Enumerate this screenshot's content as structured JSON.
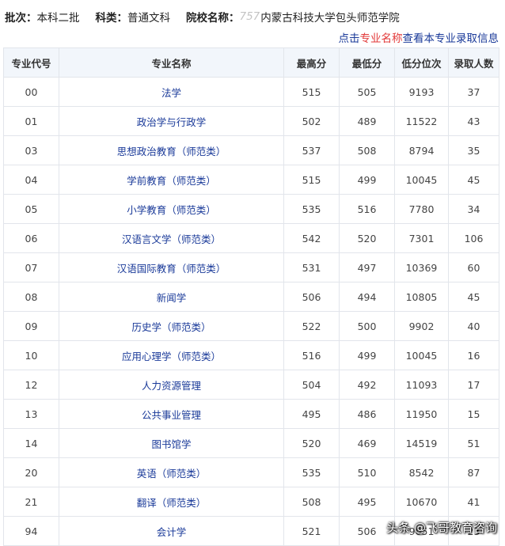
{
  "info": {
    "batch_label": "批次：",
    "batch_value": "本科二批",
    "category_label": "科类：",
    "category_value": "普通文科",
    "school_label": "院校名称：",
    "school_code": "757",
    "school_name": "内蒙古科技大学包头师范学院"
  },
  "hint": {
    "prefix": "点击",
    "highlight": "专业名称",
    "suffix": "查看本专业录取信息"
  },
  "table": {
    "headers": [
      "专业代号",
      "专业名称",
      "最高分",
      "最低分",
      "低分位次",
      "录取人数"
    ],
    "rows": [
      [
        "00",
        "法学",
        "515",
        "505",
        "9193",
        "37"
      ],
      [
        "01",
        "政治学与行政学",
        "502",
        "489",
        "11522",
        "43"
      ],
      [
        "03",
        "思想政治教育（师范类）",
        "537",
        "508",
        "8794",
        "35"
      ],
      [
        "04",
        "学前教育（师范类）",
        "515",
        "499",
        "10045",
        "45"
      ],
      [
        "05",
        "小学教育（师范类）",
        "535",
        "516",
        "7780",
        "34"
      ],
      [
        "06",
        "汉语言文学（师范类）",
        "542",
        "520",
        "7301",
        "106"
      ],
      [
        "07",
        "汉语国际教育（师范类）",
        "531",
        "497",
        "10369",
        "60"
      ],
      [
        "08",
        "新闻学",
        "506",
        "494",
        "10805",
        "45"
      ],
      [
        "09",
        "历史学（师范类）",
        "522",
        "500",
        "9902",
        "40"
      ],
      [
        "10",
        "应用心理学（师范类）",
        "516",
        "499",
        "10045",
        "16"
      ],
      [
        "12",
        "人力资源管理",
        "504",
        "492",
        "11093",
        "17"
      ],
      [
        "13",
        "公共事业管理",
        "495",
        "486",
        "11950",
        "15"
      ],
      [
        "14",
        "图书馆学",
        "520",
        "469",
        "14519",
        "51"
      ],
      [
        "20",
        "英语（师范类）",
        "535",
        "510",
        "8542",
        "87"
      ],
      [
        "21",
        "翻译（师范类）",
        "508",
        "495",
        "10670",
        "41"
      ],
      [
        "94",
        "会计学",
        "521",
        "506",
        "9651",
        "23"
      ]
    ]
  },
  "watermark": "头条 @飞哥教育咨询"
}
